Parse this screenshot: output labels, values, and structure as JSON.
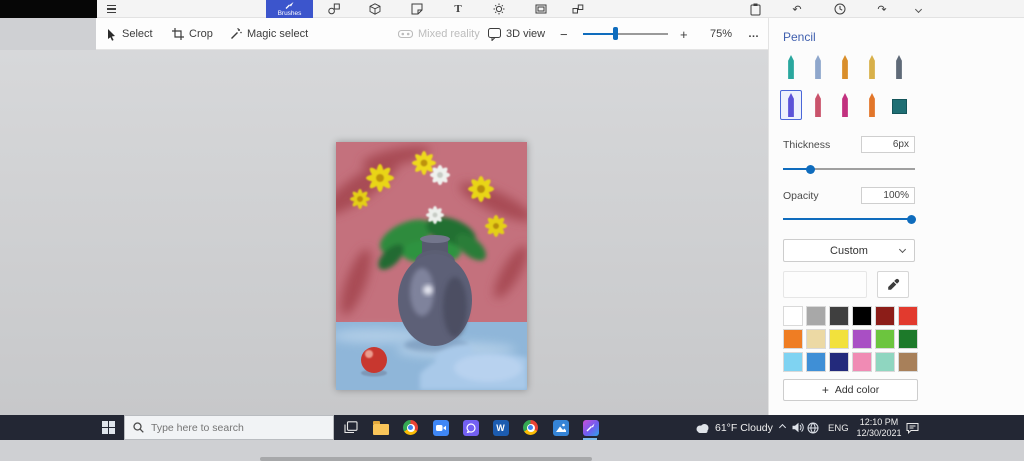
{
  "colors": {
    "accent": "#0f6cbd",
    "tab_blue": "#3c55cc",
    "taskbar_bg": "#232734",
    "canvas_bg": "#d2d3d5"
  },
  "top_bar": {
    "brushes_label": "Brushes",
    "icons": [
      "menu",
      "brushes",
      "2d-shapes",
      "3d-shapes",
      "stickers",
      "text",
      "effects",
      "canvas",
      "3d-library",
      "paste",
      "undo",
      "history",
      "redo",
      "collapse-ribbon"
    ]
  },
  "toolbar": {
    "select_label": "Select",
    "crop_label": "Crop",
    "magic_select_label": "Magic select",
    "mixed_reality_label": "Mixed reality",
    "view_3d_label": "3D view",
    "zoom_minus": "−",
    "zoom_plus": "+",
    "zoom_value": "75%",
    "more_label": "…"
  },
  "side_panel": {
    "title": "Pencil",
    "brushes": [
      {
        "name": "marker",
        "color": "#2aa79e"
      },
      {
        "name": "calligraphy-pen",
        "color": "#8fa7cc"
      },
      {
        "name": "oil-brush",
        "color": "#d98e2b"
      },
      {
        "name": "watercolor",
        "color": "#d8b04a"
      },
      {
        "name": "pixel-pen",
        "color": "#5f6a78"
      },
      {
        "name": "pencil",
        "color": "#5b53d8",
        "selected": true
      },
      {
        "name": "eraser",
        "color": "#c9536b"
      },
      {
        "name": "crayon",
        "color": "#c2317f"
      },
      {
        "name": "spray-can",
        "color": "#e2762a"
      },
      {
        "name": "fill",
        "color": "#1f6f74"
      }
    ],
    "thickness": {
      "label": "Thickness",
      "value": "6px"
    },
    "opacity": {
      "label": "Opacity",
      "value": "100%"
    },
    "custom_label": "Custom",
    "add_color_plus": "+",
    "add_color_label": "Add color",
    "palette": [
      "#ffffff",
      "#a8a8a8",
      "#3f3f3f",
      "#000000",
      "#8c1d18",
      "#e23a2e",
      "#ef7d23",
      "#ecd9a4",
      "#f2e13c",
      "#a94fc4",
      "#6cc53e",
      "#1d7a2a",
      "#7fd3f2",
      "#3f8fd6",
      "#232a7c",
      "#f08bb4",
      "#8fd6c0",
      "#a8805a"
    ]
  },
  "taskbar": {
    "search_placeholder": "Type here to search",
    "app_icons": [
      "start",
      "search",
      "task-view",
      "file-explorer",
      "chrome",
      "zoom",
      "viber",
      "word",
      "browser",
      "photos",
      "paint-3d"
    ],
    "word_glyph": "W",
    "weather_label": "61°F Cloudy",
    "tray_icons": [
      "hidden-icons",
      "volume",
      "network",
      "language",
      "clock",
      "notifications"
    ],
    "language_label": "ENG",
    "time": "12:10 PM",
    "date": "12/30/2021"
  }
}
